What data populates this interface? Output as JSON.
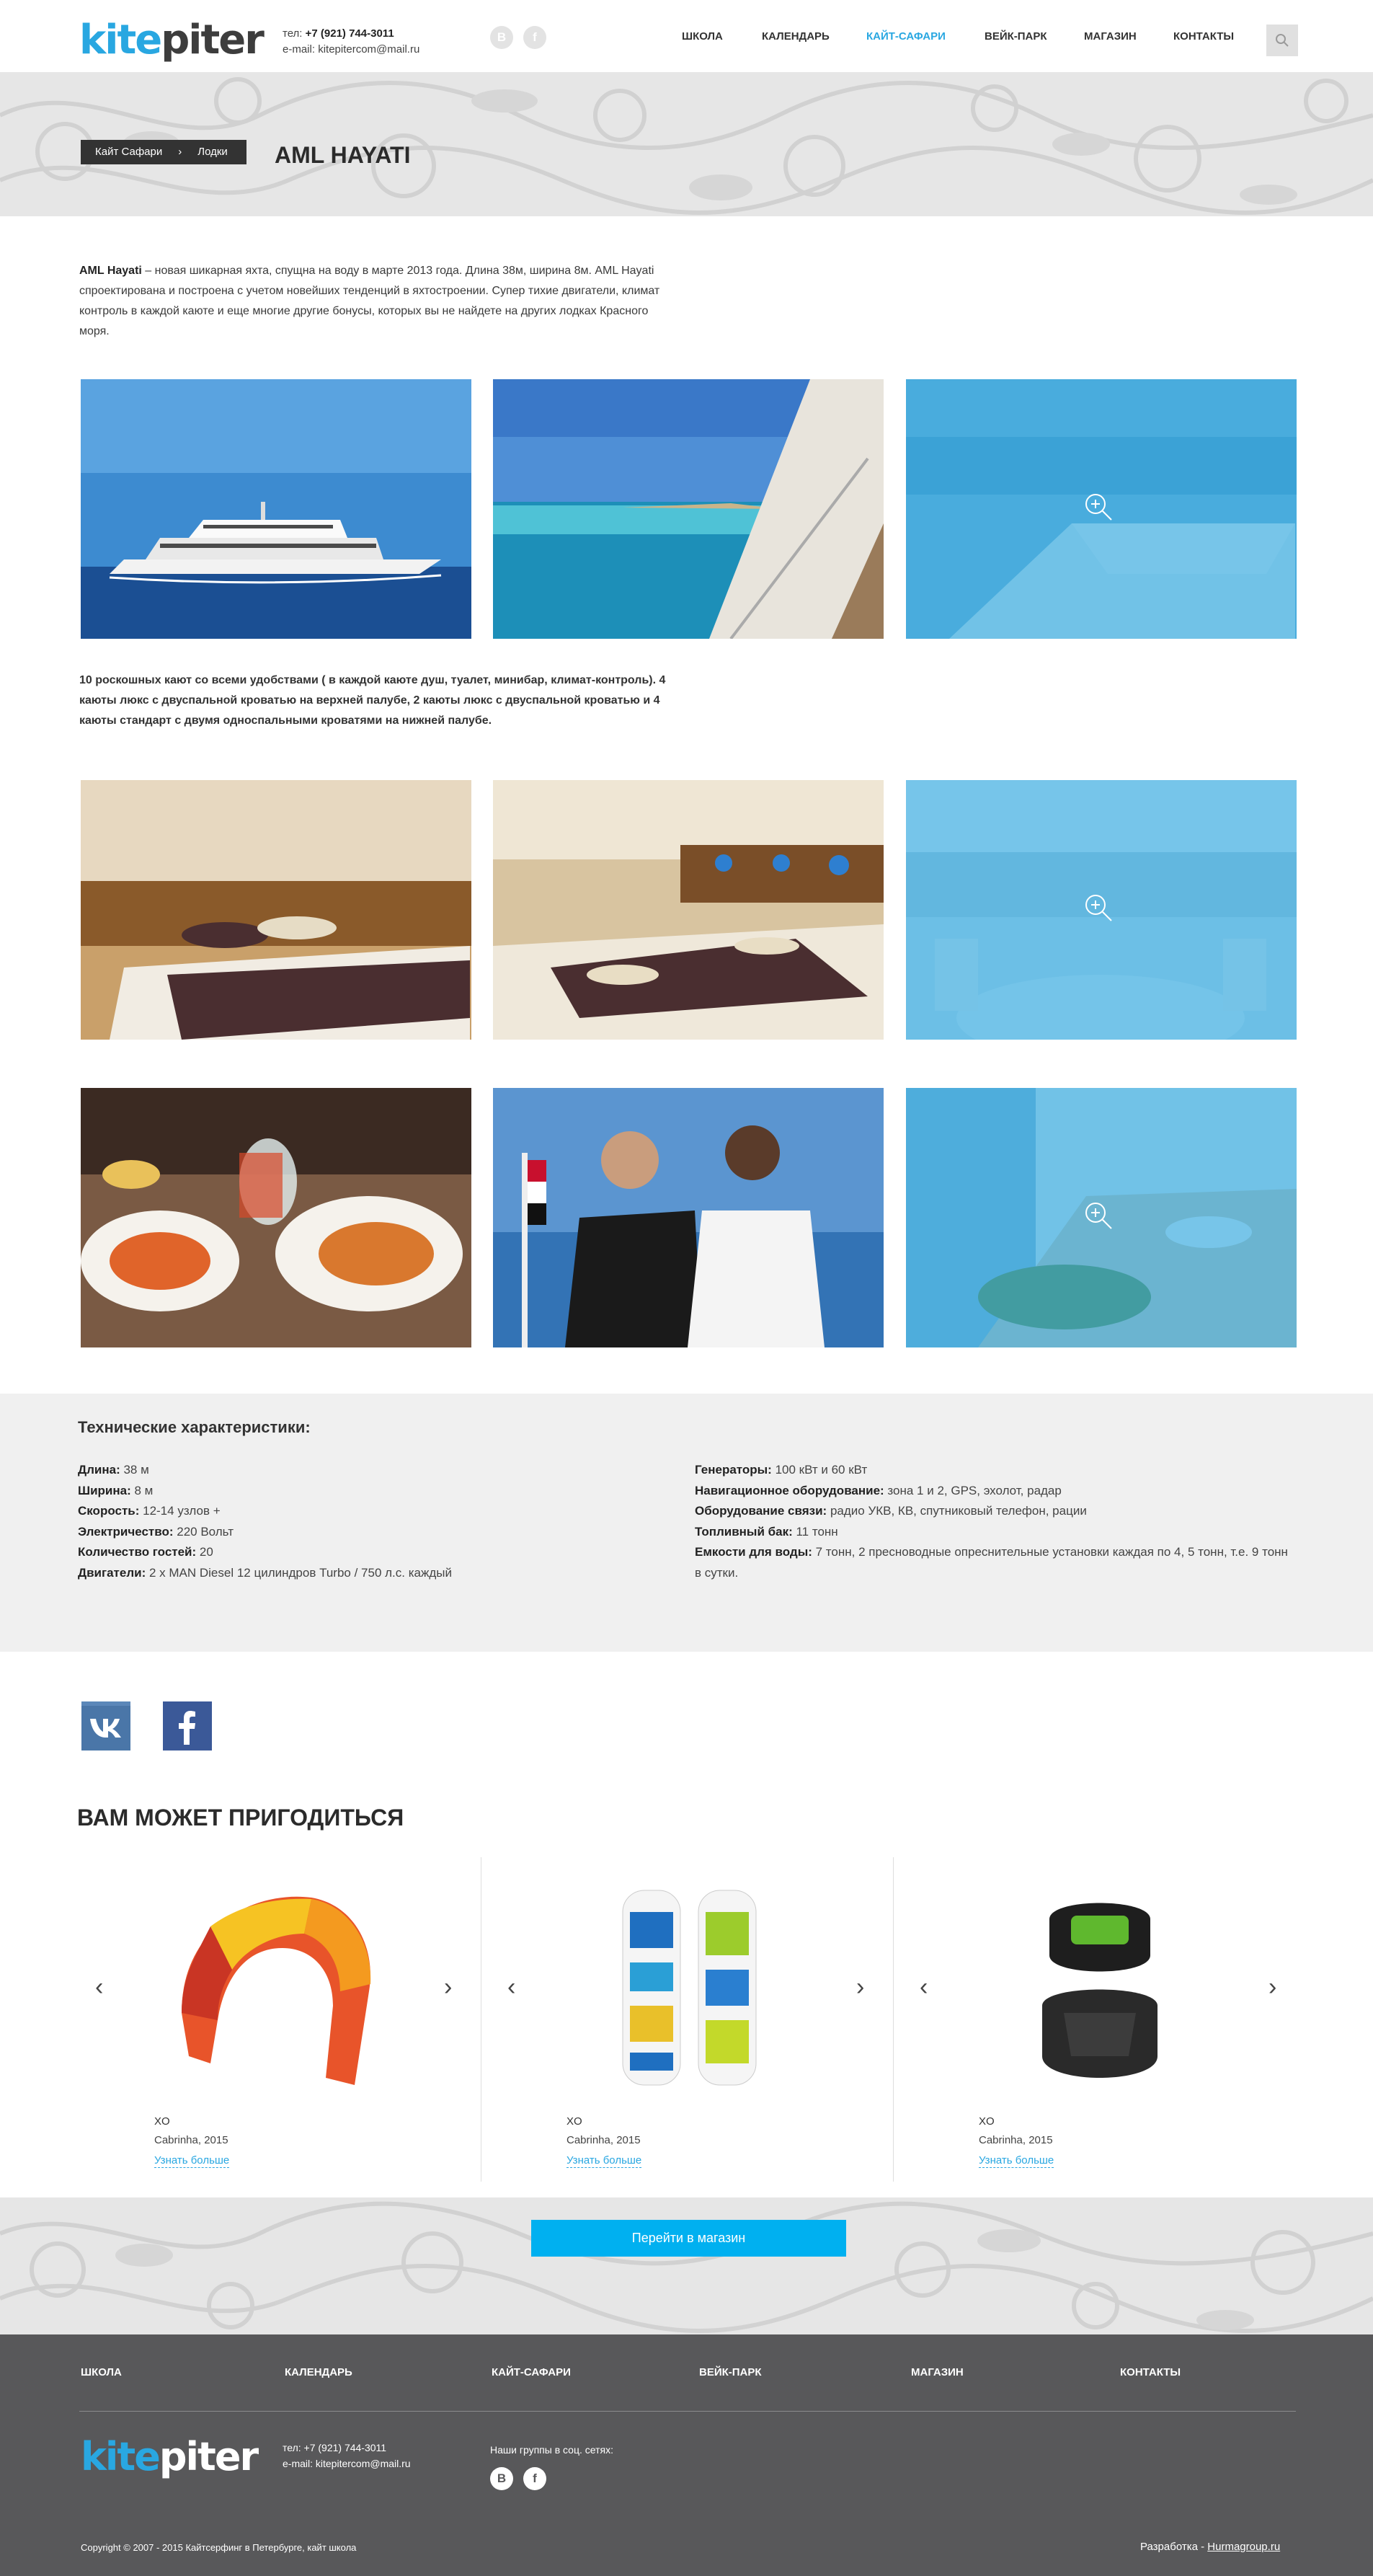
{
  "header": {
    "logo_kite": "kite",
    "logo_piter": "piter",
    "phone_label": "тел:",
    "phone": "+7 (921) 744-3011",
    "email_label": "e-mail:",
    "email": "kitepitercom@mail.ru",
    "social": [
      "B",
      "f"
    ],
    "nav": [
      "ШКОЛА",
      "КАЛЕНДАРЬ",
      "КАЙТ-САФАРИ",
      "ВЕЙК-ПАРК",
      "МАГАЗИН",
      "КОНТАКТЫ"
    ],
    "active_nav": "КАЙТ-САФАРИ"
  },
  "hero": {
    "breadcrumb": [
      "Кайт Сафари",
      "Лодки"
    ],
    "breadcrumb_sep": "›",
    "title": "AML HAYATI"
  },
  "intro": {
    "name": "AML Hayati",
    "text": " – новая шикарная яхта, спущна на воду в марте 2013 года. Длина 38м, ширина 8м. AML Hayati спроектирована и построена с учетом новейших тенденций в яхтостроении. Супер тихие двигатели, климат контроль в каждой каюте и еще многие другие бонусы, которых вы не найдете на других лодках Красного моря."
  },
  "cabins_text": "10 роскошных кают со всеми удобствами ( в каждой каюте душ, туалет,  минибар, климат-контроль). 4 каюты люкс с двуспальной кроватью на верхней палубе, 2 каюты люкс с двуспальной кроватью и 4 каюты стандарт с двумя односпальными кроватями на нижней палубе.",
  "specs": {
    "title": "Технические характеристики:",
    "left": [
      {
        "label": "Длина:",
        "value": " 38 м"
      },
      {
        "label": "Ширина:",
        "value": " 8 м"
      },
      {
        "label": "Скорость:",
        "value": " 12-14 узлов +"
      },
      {
        "label": "Электричество:",
        "value": " 220 Вольт"
      },
      {
        "label": "Количество гостей:",
        "value": " 20"
      },
      {
        "label": "Двигатели:",
        "value": " 2 x MAN Diesel 12 цилиндров Turbo / 750 л.с. каждый"
      }
    ],
    "right": [
      {
        "label": "Генераторы:",
        "value": " 100 кВт и 60 кВт"
      },
      {
        "label": "Навигационное оборудование:",
        "value": " зона 1 и 2, GPS, эхолот, радар"
      },
      {
        "label": "Оборудование связи:",
        "value": " радио УКВ, КВ, спутниковый телефон, рации"
      },
      {
        "label": "Топливный бак:",
        "value": " 11 тонн"
      },
      {
        "label": "Емкости для воды:",
        "value": " 7 тонн, 2 пресноводные опреснительные установки каждая по 4, 5 тонн, т.е. 9 тонн в сутки."
      }
    ]
  },
  "social_squares": [
    "vk",
    "f"
  ],
  "maybe": {
    "title": "ВАМ МОЖЕТ ПРИГОДИТЬСЯ",
    "arrow_prev": "‹",
    "arrow_next": "›",
    "products": [
      {
        "name": "XO",
        "brand": "Cabrinha, 2015",
        "more": "Узнать больше",
        "image": "kite"
      },
      {
        "name": "XO",
        "brand": "Cabrinha, 2015",
        "more": "Узнать больше",
        "image": "kiteboards"
      },
      {
        "name": "XO",
        "brand": "Cabrinha, 2015",
        "more": "Узнать больше",
        "image": "harness"
      }
    ],
    "shop_button": "Перейти в магазин"
  },
  "footer": {
    "nav": [
      "ШКОЛА",
      "КАЛЕНДАРЬ",
      "КАЙТ-САФАРИ",
      "ВЕЙК-ПАРК",
      "МАГАЗИН",
      "КОНТАКТЫ"
    ],
    "logo_kite": "kite",
    "logo_piter": "piter",
    "phone": "тел: +7 (921) 744-3011",
    "email": "e-mail: kitepitercom@mail.ru",
    "groups_label": "Наши группы в соц. сетях:",
    "social": [
      "B",
      "f"
    ],
    "copyright": "Copyright © 2007 - 2015 Кайтсерфинг в Петербурге, кайт школа",
    "dev_label": "Разработка - ",
    "dev_link": "Hurmagroup.ru"
  },
  "colors": {
    "accent": "#29a7e1",
    "button": "#00b0f0",
    "footer_bg": "#58585a",
    "specs_bg": "#f0f0f0",
    "overlay": "#29a7e1"
  }
}
